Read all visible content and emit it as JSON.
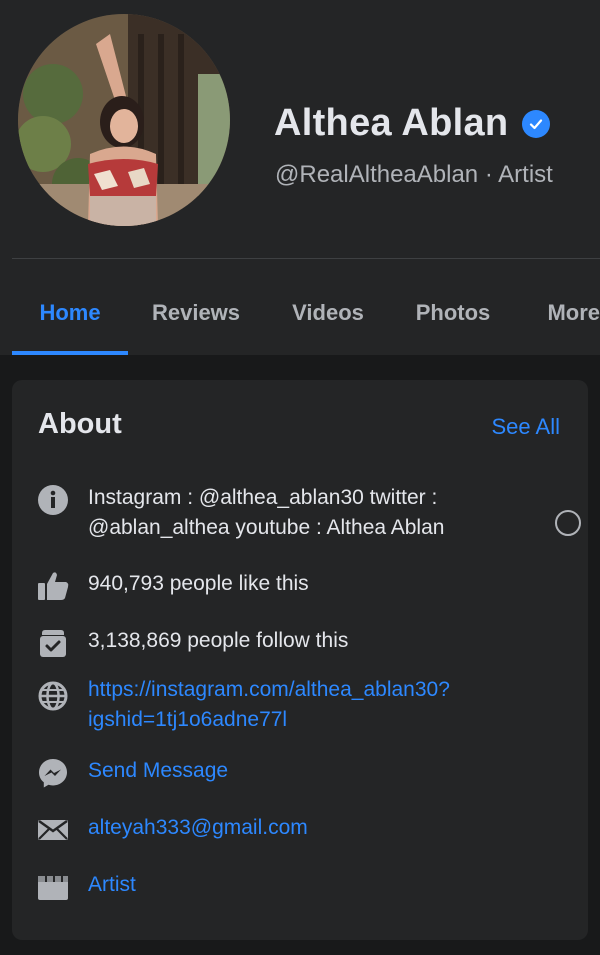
{
  "profile": {
    "name": "Althea Ablan",
    "handle": "@RealAltheaAblan · Artist"
  },
  "tabs": [
    {
      "label": "Home"
    },
    {
      "label": "Reviews"
    },
    {
      "label": "Videos"
    },
    {
      "label": "Photos"
    },
    {
      "label": "More"
    }
  ],
  "about": {
    "title": "About",
    "see_all": "See All",
    "bio_line1": "Instagram : @althea_ablan30 twitter :",
    "bio_line2": "@ablan_althea youtube : Althea Ablan",
    "likes": "940,793 people like this",
    "follows": "3,138,869 people follow this",
    "website_line1": "https://instagram.com/althea_ablan30?",
    "website_line2": "igshid=1tj1o6adne77l",
    "message": "Send Message",
    "email": "alteyah333@gmail.com",
    "category": "Artist"
  },
  "colors": {
    "accent": "#2d88ff",
    "background": "#18191a",
    "card": "#242526"
  }
}
